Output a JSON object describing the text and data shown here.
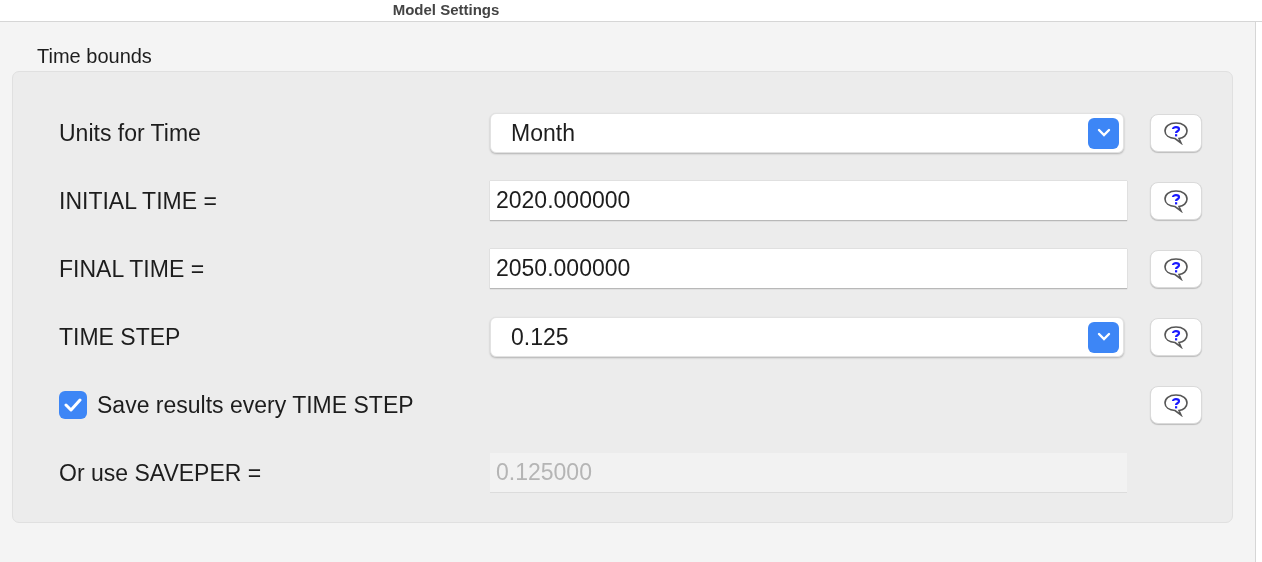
{
  "window": {
    "title": "Model Settings"
  },
  "group": {
    "title": "Time bounds",
    "rows": [
      {
        "kind": "select",
        "label": "Units for Time",
        "value": "Month",
        "help": true
      },
      {
        "kind": "text",
        "label": "INITIAL TIME =",
        "value": "2020.000000",
        "disabled": false,
        "help": true
      },
      {
        "kind": "text",
        "label": "FINAL TIME =",
        "value": "2050.000000",
        "disabled": false,
        "help": true
      },
      {
        "kind": "select",
        "label": "TIME STEP",
        "value": "0.125",
        "help": true
      },
      {
        "kind": "checkbox",
        "label": "Save results every TIME STEP",
        "checked": true,
        "help": true
      },
      {
        "kind": "text",
        "label": "Or use SAVEPER =",
        "value": "0.125000",
        "disabled": true,
        "help": false
      }
    ]
  }
}
